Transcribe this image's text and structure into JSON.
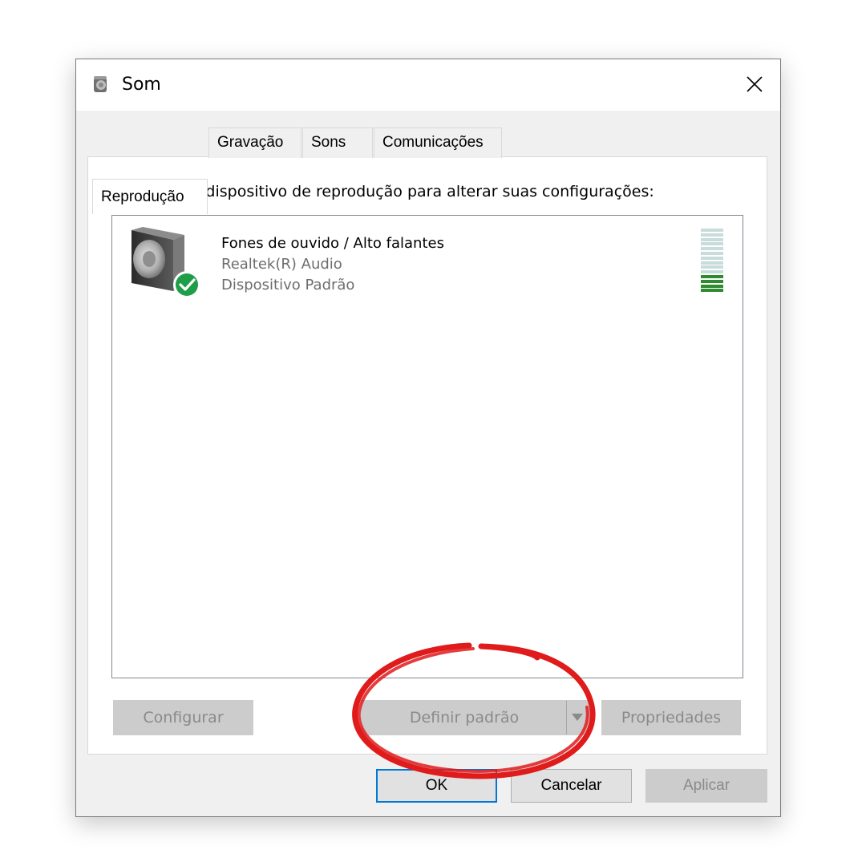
{
  "window": {
    "title": "Som",
    "icons": {
      "title": "speaker-icon",
      "close": "close-icon"
    }
  },
  "tabs": [
    {
      "label": "Reprodução",
      "active": true
    },
    {
      "label": "Gravação",
      "active": false
    },
    {
      "label": "Sons",
      "active": false
    },
    {
      "label": "Comunicações",
      "active": false
    }
  ],
  "playback": {
    "instruction": "Selecione um dispositivo de reprodução para alterar suas configurações:",
    "devices": [
      {
        "name": "Fones de ouvido / Alto falantes",
        "driver": "Realtek(R) Audio",
        "status": "Dispositivo Padrão",
        "icon": "speaker-with-check-icon",
        "level_fraction": 0.3
      }
    ],
    "buttons": {
      "configure": "Configurar",
      "set_default": "Definir padrão",
      "properties": "Propriedades"
    }
  },
  "footer": {
    "ok": "OK",
    "cancel": "Cancelar",
    "apply": "Aplicar"
  },
  "colors": {
    "accent": "#0078d7",
    "level_active": "#2e8b2e",
    "level_inactive": "#c8dcdc",
    "annotation": "#e01b1b",
    "check_badge": "#1e9e49"
  }
}
